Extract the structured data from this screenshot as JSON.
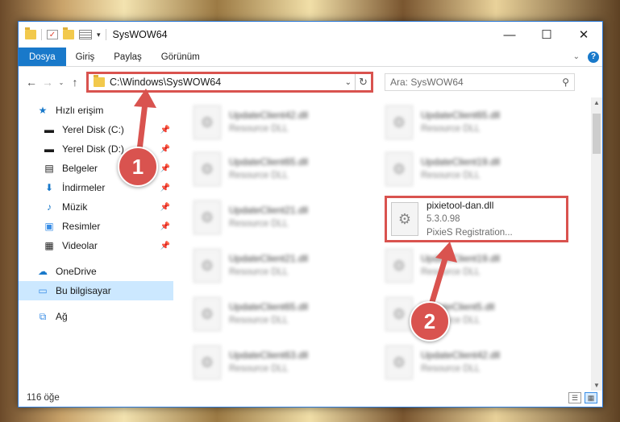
{
  "window": {
    "title": "SysWOW64"
  },
  "winbtns": {
    "minimize": "—",
    "maximize": "☐",
    "close": "✕"
  },
  "ribbon": {
    "tabs": [
      "Dosya",
      "Giriş",
      "Paylaş",
      "Görünüm"
    ],
    "active_tab": "Dosya"
  },
  "nav": {
    "back": "←",
    "forward": "→",
    "recent": "⌄",
    "up": "↑"
  },
  "address": {
    "path": "C:\\Windows\\SysWOW64",
    "dropdown": "⌄",
    "refresh": "↻"
  },
  "search": {
    "placeholder": "Ara: SysWOW64"
  },
  "sidebar": {
    "quick_access": "Hızlı erişim",
    "items": [
      {
        "label": "Yerel Disk (C:)",
        "icon": "drive-icon"
      },
      {
        "label": "Yerel Disk (D:)",
        "icon": "drive-icon"
      },
      {
        "label": "Belgeler",
        "icon": "documents-icon"
      },
      {
        "label": "İndirmeler",
        "icon": "downloads-icon"
      },
      {
        "label": "Müzik",
        "icon": "music-icon"
      },
      {
        "label": "Resimler",
        "icon": "pictures-icon"
      },
      {
        "label": "Videolar",
        "icon": "videos-icon"
      }
    ],
    "onedrive": "OneDrive",
    "this_pc": "Bu bilgisayar",
    "network": "Ağ"
  },
  "files": [
    {
      "name": "UpdateClient42.dll",
      "type": "Resource DLL",
      "blur": true
    },
    {
      "name": "UpdateClient65.dll",
      "type": "Resource DLL",
      "blur": true
    },
    {
      "name": "UpdateClient65.dll",
      "type": "Resource DLL",
      "blur": true
    },
    {
      "name": "UpdateClient19.dll",
      "type": "Resource DLL",
      "blur": true
    },
    {
      "name": "UpdateClient21.dll",
      "type": "Resource DLL",
      "blur": true
    },
    {
      "name": "pixietool-dan.dll",
      "version": "5.3.0.98",
      "type": "PixieS Registration...",
      "blur": false,
      "highlighted": true
    },
    {
      "name": "UpdateClient21.dll",
      "type": "Resource DLL",
      "blur": true
    },
    {
      "name": "UpdateClient19.dll",
      "type": "Resource DLL",
      "blur": true
    },
    {
      "name": "UpdateClient65.dll",
      "type": "Resource DLL",
      "blur": true
    },
    {
      "name": "UpdateClient5.dll",
      "type": "Resource DLL",
      "blur": true
    },
    {
      "name": "UpdateClient63.dll",
      "type": "Resource DLL",
      "blur": true
    },
    {
      "name": "UpdateClient42.dll",
      "type": "Resource DLL",
      "blur": true
    }
  ],
  "status": {
    "count": "116 öğe"
  },
  "annotations": {
    "step1": "1",
    "step2": "2",
    "color": "#d9534f"
  }
}
